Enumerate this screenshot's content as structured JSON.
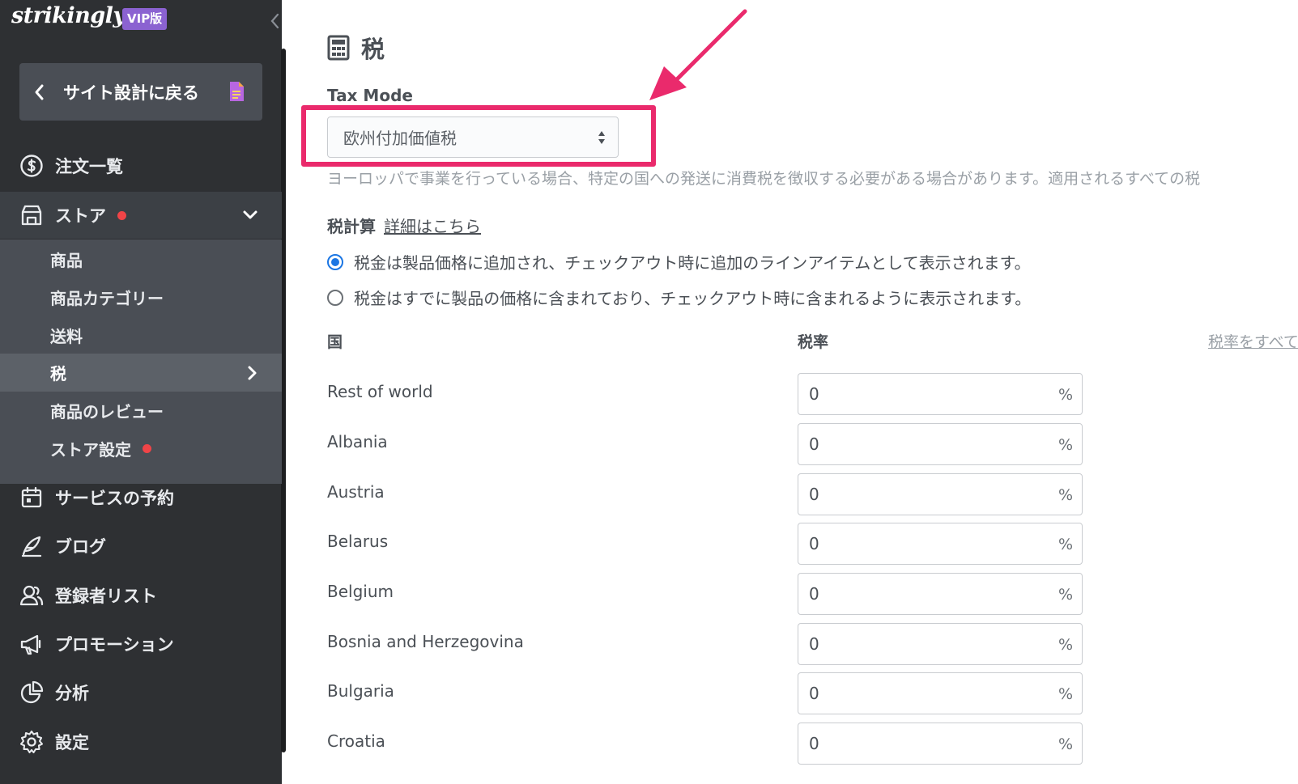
{
  "sidebar": {
    "logo": "strikingly",
    "badge": "VIP版",
    "back_label": "サイト設計に戻る",
    "nav": {
      "orders": "注文一覧",
      "store": "ストア",
      "booking": "サービスの予約",
      "blog": "ブログ",
      "subscribers": "登録者リスト",
      "promotion": "プロモーション",
      "analytics": "分析",
      "settings": "設定"
    },
    "store_sub": {
      "products": "商品",
      "categories": "商品カテゴリー",
      "shipping": "送料",
      "tax": "税",
      "reviews": "商品のレビュー",
      "store_settings": "ストア設定"
    }
  },
  "main": {
    "title": "税",
    "tax_mode_label": "Tax Mode",
    "tax_mode_value": "欧州付加価値税",
    "hint": "ヨーロッパで事業を行っている場合、特定の国への発送に消費税を徴収する必要がある場合があります。適用されるすべての税",
    "calc_label": "税計算",
    "calc_link": "詳細はこちら",
    "radio_options": [
      "税金は製品価格に追加され、チェックアウト時に追加のラインアイテムとして表示されます。",
      "税金はすでに製品の価格に含まれており、チェックアウト時に含まれるように表示されます。"
    ],
    "col_country": "国",
    "col_rate": "税率",
    "col_apply": "税率をすべて",
    "percent": "%",
    "rows": [
      {
        "country": "Rest of world",
        "rate": "0"
      },
      {
        "country": "Albania",
        "rate": "0"
      },
      {
        "country": "Austria",
        "rate": "0"
      },
      {
        "country": "Belarus",
        "rate": "0"
      },
      {
        "country": "Belgium",
        "rate": "0"
      },
      {
        "country": "Bosnia and Herzegovina",
        "rate": "0"
      },
      {
        "country": "Bulgaria",
        "rate": "0"
      },
      {
        "country": "Croatia",
        "rate": "0"
      }
    ]
  },
  "colors": {
    "sidebar_bg": "#2e3033",
    "accent_highlight": "#ea2a6c",
    "radio_blue": "#1b76e3",
    "badge_purple": "#8b62d1",
    "notify_red": "#f04447"
  }
}
